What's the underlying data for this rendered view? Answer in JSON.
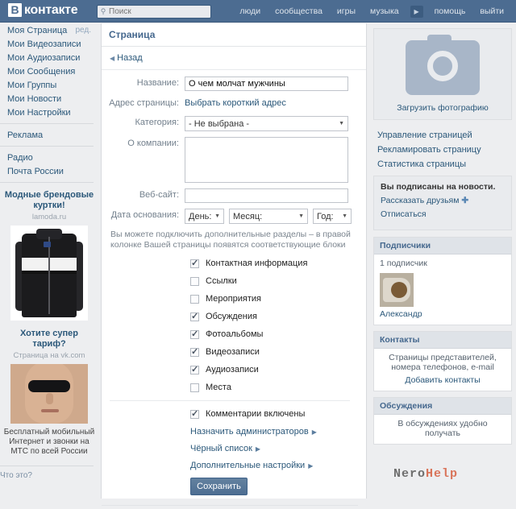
{
  "header": {
    "logo_mark": "В",
    "logo_text": "контакте",
    "search": {
      "placeholder": "Поиск",
      "value": "",
      "icon": "search-icon"
    },
    "nav": [
      {
        "label": "люди"
      },
      {
        "label": "сообщества"
      },
      {
        "label": "игры"
      },
      {
        "label": "музыка"
      }
    ],
    "nav_more_icon": "▶",
    "nav_right": [
      {
        "label": "помощь"
      },
      {
        "label": "выйти"
      }
    ]
  },
  "sidebar": {
    "items": [
      {
        "label": "Моя Страница",
        "extra": "ред."
      },
      {
        "label": "Мои Видеозаписи"
      },
      {
        "label": "Мои Аудиозаписи"
      },
      {
        "label": "Мои Сообщения"
      },
      {
        "label": "Мои Группы"
      },
      {
        "label": "Мои Новости"
      },
      {
        "label": "Мои Настройки"
      }
    ],
    "group2": [
      {
        "label": "Реклама"
      }
    ],
    "group3": [
      {
        "label": "Радио"
      },
      {
        "label": "Почта России"
      }
    ],
    "ads": [
      {
        "title": "Модные брендовые куртки!",
        "domain": "lamoda.ru",
        "image": "jacket-photo",
        "desc": ""
      },
      {
        "title": "Хотите супер тариф?",
        "domain": "Страница на vk.com",
        "image": "face-photo",
        "desc": "Бесплатный мобильный Интернет и звонки на МТС по всей России"
      }
    ],
    "ad_footer": "Что это?"
  },
  "main": {
    "title": "Страница",
    "back_label": "Назад",
    "back_icon": "◀",
    "fields": [
      {
        "label": "Название:",
        "type": "text",
        "value": "О чем молчат мужчины"
      },
      {
        "label": "Адрес страницы:",
        "type": "link",
        "value": "Выбрать короткий адрес"
      },
      {
        "label": "Категория:",
        "type": "select",
        "value": "- Не выбрана -"
      },
      {
        "label": "О компании:",
        "type": "textarea",
        "value": ""
      },
      {
        "label": "Веб-сайт:",
        "type": "text",
        "value": ""
      }
    ],
    "date_label": "Дата основания:",
    "date_selects": [
      {
        "value": "День:"
      },
      {
        "value": "Месяц:"
      },
      {
        "value": "Год:"
      }
    ],
    "note": "Вы можете подключить дополнительные разделы – в правой колонке Вашей страницы появятся соответствующие блоки",
    "checkboxes": [
      {
        "label": "Контактная информация",
        "checked": true
      },
      {
        "label": "Ссылки",
        "checked": false
      },
      {
        "label": "Мероприятия",
        "checked": false
      },
      {
        "label": "Обсуждения",
        "checked": true
      },
      {
        "label": "Фотоальбомы",
        "checked": true
      },
      {
        "label": "Видеозаписи",
        "checked": true
      },
      {
        "label": "Аудиозаписи",
        "checked": true
      },
      {
        "label": "Места",
        "checked": false
      }
    ],
    "comments_checkbox": {
      "label": "Комментарии включены",
      "checked": true
    },
    "arrow_links": [
      {
        "label": "Назначить администраторов",
        "icon": "▶"
      },
      {
        "label": "Чёрный список",
        "icon": "▶"
      },
      {
        "label": "Дополнительные настройки",
        "icon": "▶"
      }
    ],
    "save_label": "Сохранить"
  },
  "right": {
    "photo": {
      "caption": "Загрузить фотографию",
      "icon": "camera-icon"
    },
    "manage_links": [
      {
        "label": "Управление страницей"
      },
      {
        "label": "Рекламировать страницу"
      },
      {
        "label": "Статистика страницы"
      }
    ],
    "subscription": {
      "status": "Вы подписаны на новости.",
      "tell_friends": "Рассказать друзьям",
      "plus_icon": "✚",
      "unsubscribe": "Отписаться"
    },
    "subscribers": {
      "title": "Подписчики",
      "count_label": "1 подписчик",
      "member_name": "Александр",
      "avatar": "cat-avatar"
    },
    "contacts": {
      "title": "Контакты",
      "description": "Страницы представителей, номера телефонов, e-mail",
      "add_label": "Добавить контакты"
    },
    "discussions": {
      "title": "Обсуждения",
      "description": "В обсуждениях удобно получать"
    }
  },
  "watermark": {
    "part1": "Nero",
    "part2": "Help"
  },
  "colors": {
    "header_bg": "#4c6c91",
    "link": "#2b587a",
    "page_bg": "#edeef0",
    "panel_bg": "#ffffff",
    "section_head_bg": "#dfe3e8",
    "button_bg": "#4d6e92"
  }
}
